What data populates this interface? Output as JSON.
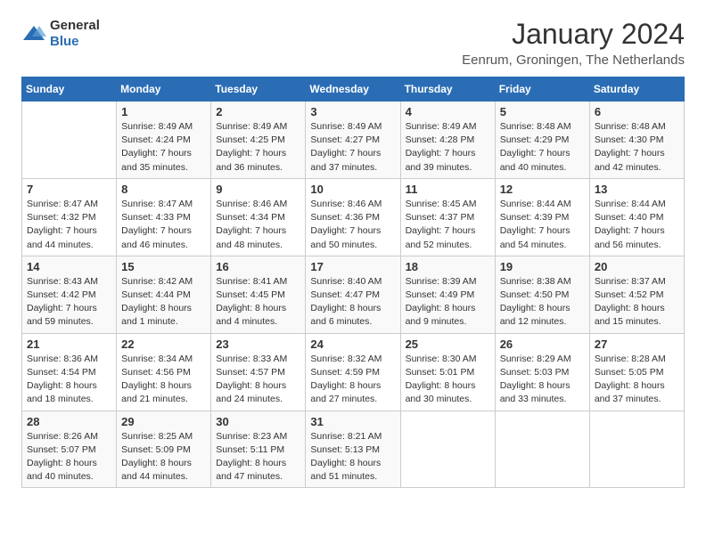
{
  "header": {
    "logo_general": "General",
    "logo_blue": "Blue",
    "month_title": "January 2024",
    "location": "Eenrum, Groningen, The Netherlands"
  },
  "calendar": {
    "days_of_week": [
      "Sunday",
      "Monday",
      "Tuesday",
      "Wednesday",
      "Thursday",
      "Friday",
      "Saturday"
    ],
    "weeks": [
      [
        {
          "day": "",
          "info": ""
        },
        {
          "day": "1",
          "info": "Sunrise: 8:49 AM\nSunset: 4:24 PM\nDaylight: 7 hours\nand 35 minutes."
        },
        {
          "day": "2",
          "info": "Sunrise: 8:49 AM\nSunset: 4:25 PM\nDaylight: 7 hours\nand 36 minutes."
        },
        {
          "day": "3",
          "info": "Sunrise: 8:49 AM\nSunset: 4:27 PM\nDaylight: 7 hours\nand 37 minutes."
        },
        {
          "day": "4",
          "info": "Sunrise: 8:49 AM\nSunset: 4:28 PM\nDaylight: 7 hours\nand 39 minutes."
        },
        {
          "day": "5",
          "info": "Sunrise: 8:48 AM\nSunset: 4:29 PM\nDaylight: 7 hours\nand 40 minutes."
        },
        {
          "day": "6",
          "info": "Sunrise: 8:48 AM\nSunset: 4:30 PM\nDaylight: 7 hours\nand 42 minutes."
        }
      ],
      [
        {
          "day": "7",
          "info": "Sunrise: 8:47 AM\nSunset: 4:32 PM\nDaylight: 7 hours\nand 44 minutes."
        },
        {
          "day": "8",
          "info": "Sunrise: 8:47 AM\nSunset: 4:33 PM\nDaylight: 7 hours\nand 46 minutes."
        },
        {
          "day": "9",
          "info": "Sunrise: 8:46 AM\nSunset: 4:34 PM\nDaylight: 7 hours\nand 48 minutes."
        },
        {
          "day": "10",
          "info": "Sunrise: 8:46 AM\nSunset: 4:36 PM\nDaylight: 7 hours\nand 50 minutes."
        },
        {
          "day": "11",
          "info": "Sunrise: 8:45 AM\nSunset: 4:37 PM\nDaylight: 7 hours\nand 52 minutes."
        },
        {
          "day": "12",
          "info": "Sunrise: 8:44 AM\nSunset: 4:39 PM\nDaylight: 7 hours\nand 54 minutes."
        },
        {
          "day": "13",
          "info": "Sunrise: 8:44 AM\nSunset: 4:40 PM\nDaylight: 7 hours\nand 56 minutes."
        }
      ],
      [
        {
          "day": "14",
          "info": "Sunrise: 8:43 AM\nSunset: 4:42 PM\nDaylight: 7 hours\nand 59 minutes."
        },
        {
          "day": "15",
          "info": "Sunrise: 8:42 AM\nSunset: 4:44 PM\nDaylight: 8 hours\nand 1 minute."
        },
        {
          "day": "16",
          "info": "Sunrise: 8:41 AM\nSunset: 4:45 PM\nDaylight: 8 hours\nand 4 minutes."
        },
        {
          "day": "17",
          "info": "Sunrise: 8:40 AM\nSunset: 4:47 PM\nDaylight: 8 hours\nand 6 minutes."
        },
        {
          "day": "18",
          "info": "Sunrise: 8:39 AM\nSunset: 4:49 PM\nDaylight: 8 hours\nand 9 minutes."
        },
        {
          "day": "19",
          "info": "Sunrise: 8:38 AM\nSunset: 4:50 PM\nDaylight: 8 hours\nand 12 minutes."
        },
        {
          "day": "20",
          "info": "Sunrise: 8:37 AM\nSunset: 4:52 PM\nDaylight: 8 hours\nand 15 minutes."
        }
      ],
      [
        {
          "day": "21",
          "info": "Sunrise: 8:36 AM\nSunset: 4:54 PM\nDaylight: 8 hours\nand 18 minutes."
        },
        {
          "day": "22",
          "info": "Sunrise: 8:34 AM\nSunset: 4:56 PM\nDaylight: 8 hours\nand 21 minutes."
        },
        {
          "day": "23",
          "info": "Sunrise: 8:33 AM\nSunset: 4:57 PM\nDaylight: 8 hours\nand 24 minutes."
        },
        {
          "day": "24",
          "info": "Sunrise: 8:32 AM\nSunset: 4:59 PM\nDaylight: 8 hours\nand 27 minutes."
        },
        {
          "day": "25",
          "info": "Sunrise: 8:30 AM\nSunset: 5:01 PM\nDaylight: 8 hours\nand 30 minutes."
        },
        {
          "day": "26",
          "info": "Sunrise: 8:29 AM\nSunset: 5:03 PM\nDaylight: 8 hours\nand 33 minutes."
        },
        {
          "day": "27",
          "info": "Sunrise: 8:28 AM\nSunset: 5:05 PM\nDaylight: 8 hours\nand 37 minutes."
        }
      ],
      [
        {
          "day": "28",
          "info": "Sunrise: 8:26 AM\nSunset: 5:07 PM\nDaylight: 8 hours\nand 40 minutes."
        },
        {
          "day": "29",
          "info": "Sunrise: 8:25 AM\nSunset: 5:09 PM\nDaylight: 8 hours\nand 44 minutes."
        },
        {
          "day": "30",
          "info": "Sunrise: 8:23 AM\nSunset: 5:11 PM\nDaylight: 8 hours\nand 47 minutes."
        },
        {
          "day": "31",
          "info": "Sunrise: 8:21 AM\nSunset: 5:13 PM\nDaylight: 8 hours\nand 51 minutes."
        },
        {
          "day": "",
          "info": ""
        },
        {
          "day": "",
          "info": ""
        },
        {
          "day": "",
          "info": ""
        }
      ]
    ]
  }
}
